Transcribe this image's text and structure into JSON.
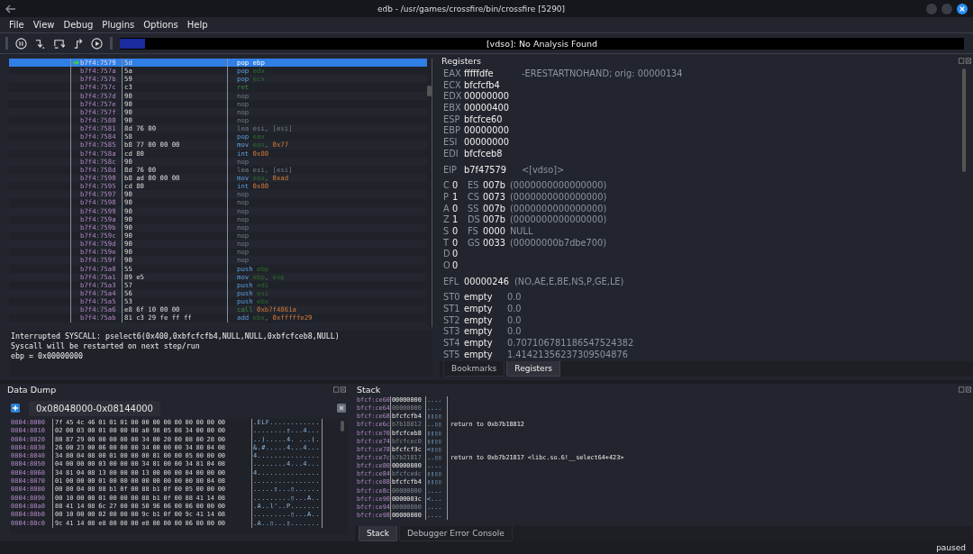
{
  "window": {
    "title": "edb - /usr/games/crossfire/bin/crossfire [5290]"
  },
  "menu": [
    "File",
    "View",
    "Debug",
    "Plugins",
    "Options",
    "Help"
  ],
  "analysis": {
    "label": "[vdso]: No Analysis Found",
    "level": 0.03
  },
  "disassembly": [
    {
      "address": "b7f4:7579",
      "bytes": "5d",
      "mnemonic": "pop",
      "kind": "stack",
      "ops": [
        {
          "text": "ebp",
          "kind": "reg"
        }
      ],
      "selected": true
    },
    {
      "address": "b7f4:757a",
      "bytes": "5a",
      "mnemonic": "pop",
      "kind": "stack",
      "ops": [
        {
          "text": "edx",
          "kind": "reg"
        }
      ],
      "selected": false
    },
    {
      "address": "b7f4:757b",
      "bytes": "59",
      "mnemonic": "pop",
      "kind": "stack",
      "ops": [
        {
          "text": "ecx",
          "kind": "reg"
        }
      ],
      "selected": false
    },
    {
      "address": "b7f4:757c",
      "bytes": "c3",
      "mnemonic": "ret",
      "kind": "flow",
      "selected": false
    },
    {
      "address": "b7f4:757d",
      "bytes": "90",
      "mnemonic": "nop",
      "kind": "nop",
      "selected": false
    },
    {
      "address": "b7f4:757e",
      "bytes": "90",
      "mnemonic": "nop",
      "kind": "nop",
      "selected": false
    },
    {
      "address": "b7f4:757f",
      "bytes": "90",
      "mnemonic": "nop",
      "kind": "nop",
      "selected": false
    },
    {
      "address": "b7f4:7580",
      "bytes": "90",
      "mnemonic": "nop",
      "kind": "nop",
      "selected": false
    },
    {
      "address": "b7f4:7581",
      "bytes": "8d 76 00",
      "mnemonic": "lea",
      "kind": "nop",
      "ops": [
        {
          "text": "esi,",
          "kind": "plain"
        },
        {
          "text": " [esi]",
          "kind": "plain"
        }
      ],
      "selected": false
    },
    {
      "address": "b7f4:7584",
      "bytes": "58",
      "mnemonic": "pop",
      "kind": "stack",
      "ops": [
        {
          "text": "eax",
          "kind": "reg"
        }
      ],
      "selected": false
    },
    {
      "address": "b7f4:7585",
      "bytes": "b8 77 00 00 00",
      "mnemonic": "mov",
      "kind": "stack",
      "ops": [
        {
          "text": "eax",
          "kind": "reg"
        },
        {
          "text": ",",
          "kind": "punct"
        },
        {
          "text": "0x77",
          "kind": "imm"
        }
      ],
      "selected": false
    },
    {
      "address": "b7f4:758a",
      "bytes": "cd 80",
      "mnemonic": "int",
      "kind": "stack",
      "ops": [
        {
          "text": "0x80",
          "kind": "imm"
        }
      ],
      "selected": false
    },
    {
      "address": "b7f4:758c",
      "bytes": "90",
      "mnemonic": "nop",
      "kind": "nop",
      "selected": false
    },
    {
      "address": "b7f4:758d",
      "bytes": "8d 76 00",
      "mnemonic": "lea",
      "kind": "nop",
      "ops": [
        {
          "text": "esi,",
          "kind": "plain"
        },
        {
          "text": " [esi]",
          "kind": "plain"
        }
      ],
      "selected": false
    },
    {
      "address": "b7f4:7590",
      "bytes": "b8 ad 00 00 00",
      "mnemonic": "mov",
      "kind": "stack",
      "ops": [
        {
          "text": "eax",
          "kind": "reg"
        },
        {
          "text": ",",
          "kind": "punct"
        },
        {
          "text": "0xad",
          "kind": "imm"
        }
      ],
      "selected": false
    },
    {
      "address": "b7f4:7595",
      "bytes": "cd 80",
      "mnemonic": "int",
      "kind": "stack",
      "ops": [
        {
          "text": "0x80",
          "kind": "imm"
        }
      ],
      "selected": false
    },
    {
      "address": "b7f4:7597",
      "bytes": "90",
      "mnemonic": "nop",
      "kind": "nop",
      "selected": false
    },
    {
      "address": "b7f4:7598",
      "bytes": "90",
      "mnemonic": "nop",
      "kind": "nop",
      "selected": false
    },
    {
      "address": "b7f4:7599",
      "bytes": "90",
      "mnemonic": "nop",
      "kind": "nop",
      "selected": false
    },
    {
      "address": "b7f4:759a",
      "bytes": "90",
      "mnemonic": "nop",
      "kind": "nop",
      "selected": false
    },
    {
      "address": "b7f4:759b",
      "bytes": "90",
      "mnemonic": "nop",
      "kind": "nop",
      "selected": false
    },
    {
      "address": "b7f4:759c",
      "bytes": "90",
      "mnemonic": "nop",
      "kind": "nop",
      "selected": false
    },
    {
      "address": "b7f4:759d",
      "bytes": "90",
      "mnemonic": "nop",
      "kind": "nop",
      "selected": false
    },
    {
      "address": "b7f4:759e",
      "bytes": "90",
      "mnemonic": "nop",
      "kind": "nop",
      "selected": false
    },
    {
      "address": "b7f4:759f",
      "bytes": "90",
      "mnemonic": "nop",
      "kind": "nop",
      "selected": false
    },
    {
      "address": "b7f4:75a0",
      "bytes": "55",
      "mnemonic": "push",
      "kind": "stack",
      "ops": [
        {
          "text": "ebp",
          "kind": "reg"
        }
      ],
      "selected": false
    },
    {
      "address": "b7f4:75a1",
      "bytes": "89 e5",
      "mnemonic": "mov",
      "kind": "stack",
      "ops": [
        {
          "text": "ebp",
          "kind": "reg"
        },
        {
          "text": ",",
          "kind": "punct"
        },
        {
          "text": "esp",
          "kind": "reg"
        }
      ],
      "selected": false
    },
    {
      "address": "b7f4:75a3",
      "bytes": "57",
      "mnemonic": "push",
      "kind": "stack",
      "ops": [
        {
          "text": "edi",
          "kind": "reg"
        }
      ],
      "selected": false
    },
    {
      "address": "b7f4:75a4",
      "bytes": "56",
      "mnemonic": "push",
      "kind": "stack",
      "ops": [
        {
          "text": "esi",
          "kind": "reg"
        }
      ],
      "selected": false
    },
    {
      "address": "b7f4:75a5",
      "bytes": "53",
      "mnemonic": "push",
      "kind": "stack",
      "ops": [
        {
          "text": "ebx",
          "kind": "reg"
        }
      ],
      "selected": false
    },
    {
      "address": "b7f4:75a6",
      "bytes": "e8 6f 10 00 00",
      "mnemonic": "call",
      "kind": "flow",
      "ops": [
        {
          "text": "0xb7f4861a",
          "kind": "imm"
        }
      ],
      "selected": false
    },
    {
      "address": "b7f4:75ab",
      "bytes": "81 c3 29 fe ff ff",
      "mnemonic": "add",
      "kind": "stack",
      "ops": [
        {
          "text": "ebx",
          "kind": "reg"
        },
        {
          "text": ",",
          "kind": "punct"
        },
        {
          "text": "0xfffffe29",
          "kind": "imm"
        }
      ],
      "selected": false
    }
  ],
  "console": [
    "Interrupted SYSCALL: pselect6(0x400,0xbfcfcfb4,NULL,NULL,0xbfcfceb8,NULL)",
    "Syscall will be restarted on next step/run",
    "ebp = 0x00000000"
  ],
  "registers": {
    "title": "Registers",
    "general": [
      {
        "name": "EAX",
        "value": "fffffdfe",
        "comment": "-ERESTARTNOHAND; orig: 00000134"
      },
      {
        "name": "ECX",
        "value": "bfcfcfb4"
      },
      {
        "name": "EDX",
        "value": "00000000"
      },
      {
        "name": "EBX",
        "value": "00000400"
      },
      {
        "name": "ESP",
        "value": "bfcfce60"
      },
      {
        "name": "EBP",
        "value": "00000000"
      },
      {
        "name": "ESI",
        "value": "00000000"
      },
      {
        "name": "EDI",
        "value": "bfcfceb8"
      }
    ],
    "eip": {
      "name": "EIP",
      "value": "b7f47579",
      "comment": "<[vdso]>"
    },
    "flags": [
      {
        "name": "C",
        "value": "0"
      },
      {
        "name": "P",
        "value": "1"
      },
      {
        "name": "A",
        "value": "0"
      },
      {
        "name": "Z",
        "value": "1"
      },
      {
        "name": "S",
        "value": "0"
      },
      {
        "name": "T",
        "value": "0"
      },
      {
        "name": "D",
        "value": "0"
      },
      {
        "name": "O",
        "value": "0"
      }
    ],
    "segments": [
      {
        "name": "ES",
        "value": "007b",
        "comment": "(0000000000000000)"
      },
      {
        "name": "CS",
        "value": "0073",
        "comment": "(0000000000000000)"
      },
      {
        "name": "SS",
        "value": "007b",
        "comment": "(0000000000000000)"
      },
      {
        "name": "DS",
        "value": "007b",
        "comment": "(0000000000000000)"
      },
      {
        "name": "FS",
        "value": "0000",
        "comment": "NULL"
      },
      {
        "name": "GS",
        "value": "0033",
        "comment": "(00000000b7dbe700)"
      }
    ],
    "efl": {
      "name": "EFL",
      "value": "00000246",
      "comment": "(NO,AE,E,BE,NS,P,GE,LE)"
    },
    "fpu": [
      {
        "name": "ST0",
        "value": "empty",
        "comment": "0.0"
      },
      {
        "name": "ST1",
        "value": "empty",
        "comment": "0.0"
      },
      {
        "name": "ST2",
        "value": "empty",
        "comment": "0.0"
      },
      {
        "name": "ST3",
        "value": "empty",
        "comment": "0.0"
      },
      {
        "name": "ST4",
        "value": "empty",
        "comment": "0.707106781186547524382"
      },
      {
        "name": "ST5",
        "value": "empty",
        "comment": "1.41421356237309504876"
      }
    ],
    "tabs": [
      {
        "label": "Bookmarks",
        "selected": false
      },
      {
        "label": "Registers",
        "selected": true
      }
    ]
  },
  "data_dump": {
    "title": "Data Dump",
    "tab": "0x08048000-0x08144000",
    "rows": [
      {
        "address": "0804:8000",
        "hex": "7f 45 4c 46 01 01 01 00 00 00 00 00 00 00 00 00",
        "ascii": ".ELF............"
      },
      {
        "address": "0804:8010",
        "hex": "02 00 03 00 01 00 00 00 a0 98 05 08 34 00 00 00",
        "ascii": "........▯...4..."
      },
      {
        "address": "0804:8020",
        "hex": "80 87 29 00 00 00 00 00 34 00 20 00 08 00 28 00",
        "ascii": "..).....4. ...(."
      },
      {
        "address": "0804:8030",
        "hex": "26 00 23 00 06 00 00 00 34 00 00 00 34 80 04 08",
        "ascii": "&.#.....4...4..."
      },
      {
        "address": "0804:8040",
        "hex": "34 80 04 08 00 01 00 00 00 01 00 00 05 00 00 00",
        "ascii": "4..............."
      },
      {
        "address": "0804:8050",
        "hex": "04 00 00 00 03 00 00 00 34 01 00 00 34 81 04 08",
        "ascii": "........4...4..."
      },
      {
        "address": "0804:8060",
        "hex": "34 81 04 08 13 00 00 00 13 00 00 00 04 00 00 00",
        "ascii": "4..............."
      },
      {
        "address": "0804:8070",
        "hex": "01 00 00 00 01 00 00 00 00 00 00 00 00 80 04 08",
        "ascii": "................"
      },
      {
        "address": "0804:8080",
        "hex": "00 80 04 08 88 b1 0f 00 88 b1 0f 00 05 00 00 00",
        "ascii": ".....▯...▯......"
      },
      {
        "address": "0804:8090",
        "hex": "00 10 00 00 01 00 00 00 88 b1 0f 00 88 41 14 08",
        "ascii": ".........▯...A.."
      },
      {
        "address": "0804:80a0",
        "hex": "88 41 14 08 6c 27 00 00 50 96 06 00 06 00 00 00",
        "ascii": ".A..l'..P......."
      },
      {
        "address": "0804:80b0",
        "hex": "00 10 00 00 02 00 00 00 9c b1 0f 00 9c 41 14 08",
        "ascii": ".........▯...A.."
      },
      {
        "address": "0804:80c0",
        "hex": "9c 41 14 08 e8 00 00 00 e8 00 00 00 06 00 00 00",
        "ascii": ".A..▯...▯......."
      }
    ]
  },
  "stack": {
    "title": "Stack",
    "rows": [
      {
        "address": "bfcf:ce60",
        "value": "00000000",
        "ascii": "...."
      },
      {
        "address": "bfcf:ce64",
        "value": "00000000",
        "ascii": "...."
      },
      {
        "address": "bfcf:ce68",
        "value": "bfcfcfb4",
        "ascii": "▯▯▯▯"
      },
      {
        "address": "bfcf:ce6c",
        "value": "b7b18812",
        "ascii": "..▯▯",
        "comment": "return to 0xb7b18812"
      },
      {
        "address": "bfcf:ce70",
        "value": "bfcfceb8",
        "ascii": "▯▯▯▯"
      },
      {
        "address": "bfcf:ce74",
        "value": "bfcfcec0",
        "ascii": "▯▯▯▯"
      },
      {
        "address": "bfcf:ce78",
        "value": "bfcfcf3c",
        "ascii": "<▯▯▯"
      },
      {
        "address": "bfcf:ce7c",
        "value": "b7b21817",
        "ascii": "..▯▯",
        "comment": "return to 0xb7b21817 <libc.so.6!__select64+423>"
      },
      {
        "address": "bfcf:ce80",
        "value": "00000000",
        "ascii": "...."
      },
      {
        "address": "bfcf:ce84",
        "value": "bfcfcedc",
        "ascii": "▯▯▯▯"
      },
      {
        "address": "bfcf:ce88",
        "value": "bfcfcfb4",
        "ascii": "▯▯▯▯"
      },
      {
        "address": "bfcf:ce8c",
        "value": "00000000",
        "ascii": "...."
      },
      {
        "address": "bfcf:ce90",
        "value": "0000003c",
        "ascii": "<..."
      },
      {
        "address": "bfcf:ce94",
        "value": "00000000",
        "ascii": "...."
      },
      {
        "address": "bfcf:ce98",
        "value": "00000000",
        "ascii": "...."
      }
    ],
    "tabs": [
      {
        "label": "Stack",
        "selected": true
      },
      {
        "label": "Debugger Error Console",
        "selected": false
      }
    ]
  },
  "status_bar": "paused"
}
